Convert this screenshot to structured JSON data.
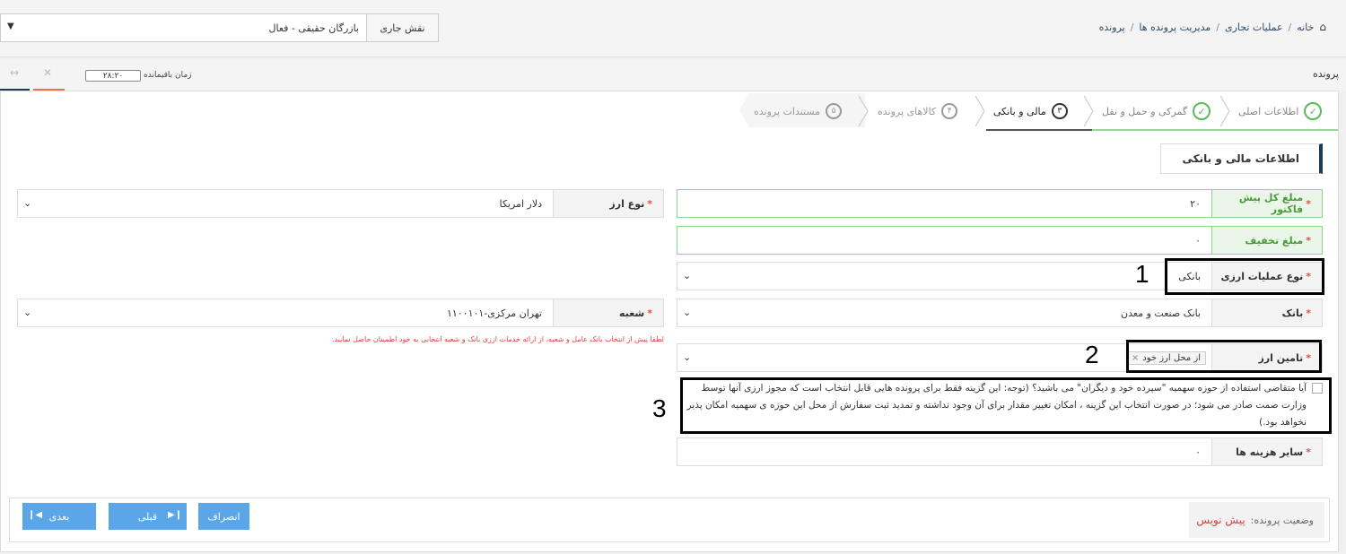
{
  "breadcrumb": {
    "home": "خانه",
    "item1": "عملیات تجاری",
    "item2": "مدیریت پرونده ها",
    "item3": "پرونده",
    "separator": "/"
  },
  "role": {
    "label": "نقش جاری",
    "value": "بازرگان حقیقی - فعال"
  },
  "file": {
    "title": "پرونده",
    "timer_label": "زمان باقیمانده",
    "timer_value": "۲۸:۲۰"
  },
  "steps": [
    {
      "label": "اطلاعات اصلی",
      "status": "done"
    },
    {
      "label": "گمرکی و حمل و نقل",
      "status": "done"
    },
    {
      "label": "مالی و بانکی",
      "number": "۳",
      "status": "active"
    },
    {
      "label": "کالاهای پرونده",
      "number": "۴",
      "status": "pending"
    },
    {
      "label": "مستندات پرونده",
      "number": "۵",
      "status": "pending"
    }
  ],
  "section_title": "اطلاعات مالی و بانکی",
  "required_mark": "*",
  "form": {
    "proforma_total": {
      "label": "مبلغ کل پیش فاکتور",
      "value": "۲۰"
    },
    "currency_type": {
      "label": "نوع ارز",
      "value": "دلار امریکا"
    },
    "discount": {
      "label": "مبلغ تخفیف",
      "value": "۰"
    },
    "fx_operation_type": {
      "label": "نوع عملیات ارزی",
      "value": "بانکی"
    },
    "bank": {
      "label": "بانک",
      "value": "بانک صنعت و معدن"
    },
    "branch": {
      "label": "شعبه",
      "value": "تهران مرکزی-۱۱۰۰۱۰۱"
    },
    "hint": "لطفا پیش از انتخاب بانک عامل و شعبه، از ارائه خدمات ارزی بانک و شعبه انتخابی به خود اطمینان حاصل نمایید.",
    "fx_supply": {
      "label": "تامین ارز",
      "tag": "از محل ارز خود"
    },
    "quota_question": "آیا متقاضی استفاده از حوزه سهمیه \"سپرده خود و دیگران\" می باشید؟ (توجه: این گزینه فقط برای پرونده هایی قابل انتخاب است که مجوز ارزی آنها توسط وزارت صمت صادر می شود؛ در صورت انتخاب این گزینه ، امکان تغییر مقدار برای آن وجود نداشته و تمدید ثبت سفارش از محل این حوزه ی سهمیه امکان پذیر نخواهد بود.)",
    "other_costs": {
      "label": "سایر هزینه ها",
      "value": "۰"
    }
  },
  "annotations": [
    "1",
    "2",
    "3"
  ],
  "footer": {
    "status_label": "وضعیت پرونده:",
    "status_value": "پیش نویس",
    "cancel": "انصراف",
    "prev": "قبلی",
    "next": "بعدی"
  },
  "colors": {
    "primary_button": "#5aa6e8",
    "success": "#5cb85c",
    "danger": "#e0403a",
    "section_accent": "#1f3a55"
  }
}
